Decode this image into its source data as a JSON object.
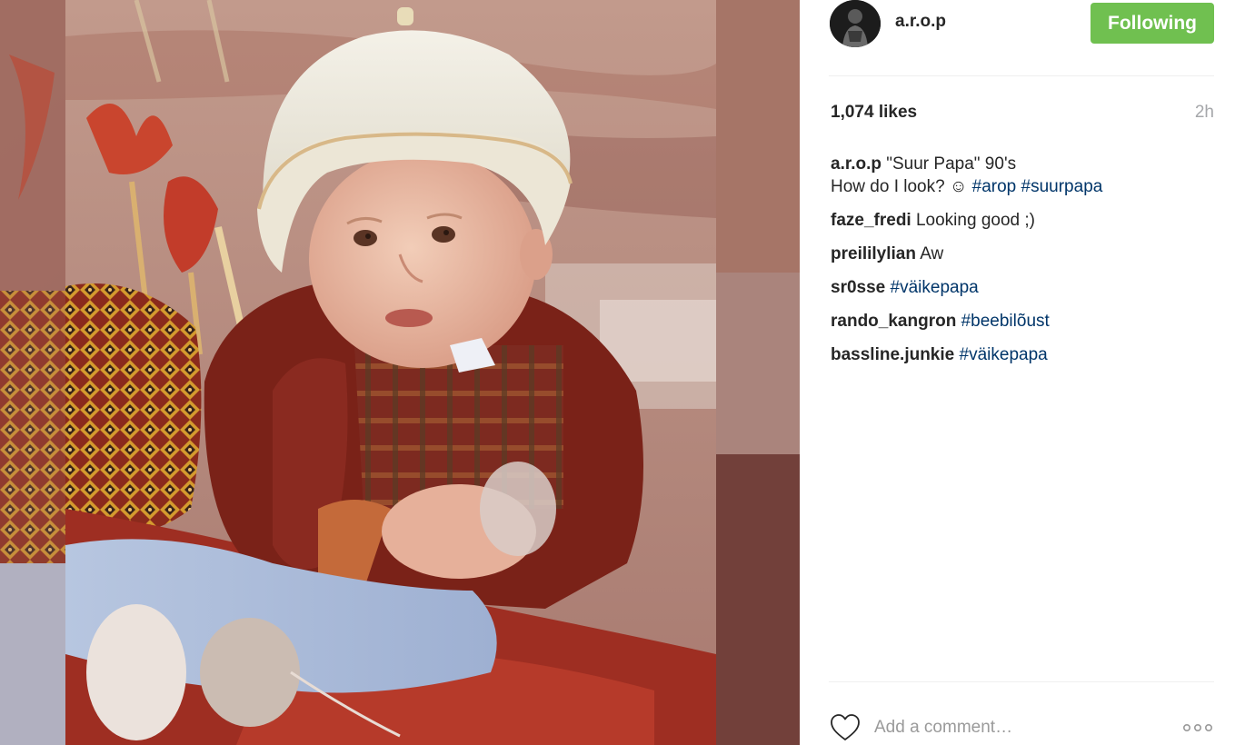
{
  "post": {
    "username": "a.r.o.p",
    "follow_label": "Following",
    "likes": "1,074 likes",
    "time": "2h"
  },
  "caption": {
    "user": "a.r.o.p",
    "text_line1": "\"Suur Papa\" 90's",
    "text_line2": "How do I look? ☺",
    "tag1": "#arop",
    "tag2": "#suurpapa"
  },
  "comments": [
    {
      "user": "faze_fredi",
      "text": "Looking good ;)"
    },
    {
      "user": "preililylian",
      "text": "Aw"
    },
    {
      "user": "sr0sse",
      "tag": "#väikepapa"
    },
    {
      "user": "rando_kangron",
      "tag": "#beebilõust"
    },
    {
      "user": "bassline.junkie",
      "tag": "#väikepapa"
    }
  ],
  "footer": {
    "placeholder": "Add a comment…"
  },
  "icons": {
    "like": "heart-icon",
    "more": "more-options-icon",
    "avatar": "profile-avatar"
  },
  "colors": {
    "follow_button": "#70c050",
    "hashtag": "#003569",
    "muted": "#a5a7aa"
  }
}
